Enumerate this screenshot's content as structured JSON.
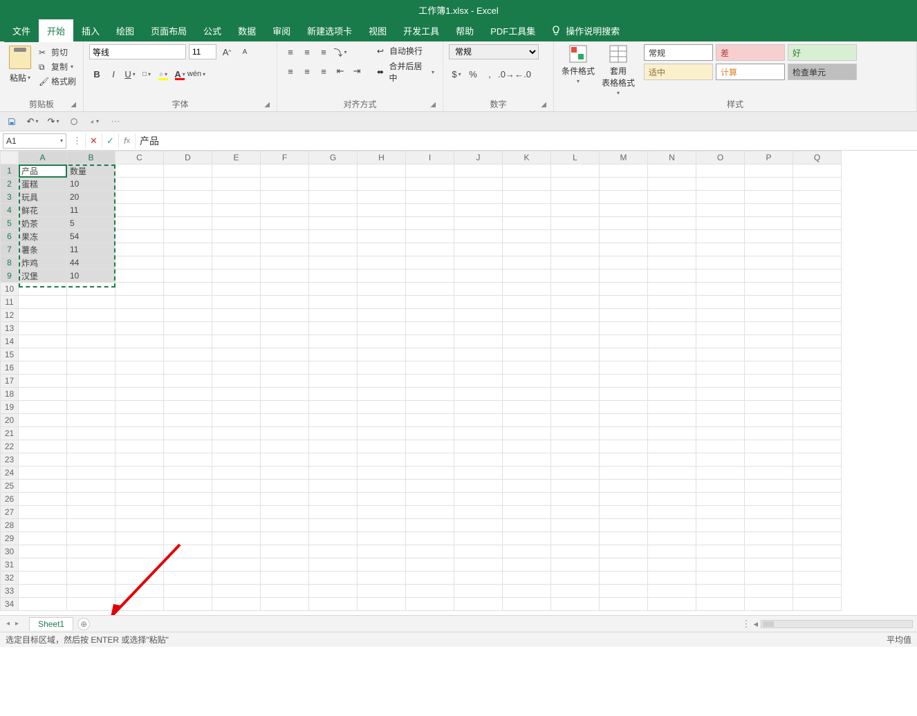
{
  "title": "工作簿1.xlsx  -  Excel",
  "menus": [
    "文件",
    "开始",
    "插入",
    "绘图",
    "页面布局",
    "公式",
    "数据",
    "审阅",
    "新建选项卡",
    "视图",
    "开发工具",
    "帮助",
    "PDF工具集"
  ],
  "active_menu": "开始",
  "tell_me": "操作说明搜索",
  "clipboard": {
    "cut": "剪切",
    "copy": "复制",
    "format_painter": "格式刷",
    "paste": "粘贴",
    "group": "剪贴板"
  },
  "font": {
    "name": "等线",
    "size": "11",
    "group": "字体"
  },
  "alignment": {
    "wrap": "自动换行",
    "merge": "合并后居中",
    "group": "对齐方式"
  },
  "number": {
    "format": "常规",
    "group": "数字"
  },
  "stylesgrp": {
    "cond": "条件格式",
    "table": "套用\n表格格式",
    "group": "样式"
  },
  "cell_styles": {
    "normal": "常规",
    "bad": "差",
    "good": "好",
    "neutral": "适中",
    "calc": "计算",
    "check": "检查单元"
  },
  "namebox": "A1",
  "formula": "产品",
  "columns": [
    "A",
    "B",
    "C",
    "D",
    "E",
    "F",
    "G",
    "H",
    "I",
    "J",
    "K",
    "L",
    "M",
    "N",
    "O",
    "P",
    "Q"
  ],
  "rows": 34,
  "sel": {
    "r1": 1,
    "c1": 1,
    "r2": 9,
    "c2": 2
  },
  "data": {
    "headers": [
      "产品",
      "数量"
    ],
    "rows": [
      [
        "蛋糕",
        "10"
      ],
      [
        "玩具",
        "20"
      ],
      [
        "鲜花",
        "11"
      ],
      [
        "奶茶",
        "5"
      ],
      [
        "果冻",
        "54"
      ],
      [
        "薯条",
        "11"
      ],
      [
        "炸鸡",
        "44"
      ],
      [
        "汉堡",
        "10"
      ]
    ]
  },
  "sheet_tab": "Sheet1",
  "status_left": "选定目标区域，然后按 ENTER 或选择\"粘贴\"",
  "status_right": "平均值"
}
